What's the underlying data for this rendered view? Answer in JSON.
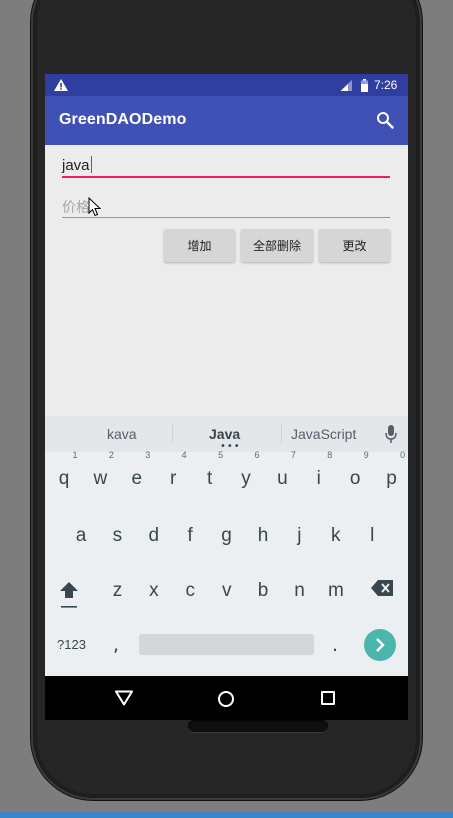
{
  "status_bar": {
    "time": "7:26"
  },
  "app_bar": {
    "title": "GreenDAODemo"
  },
  "form": {
    "name_value": "java",
    "price_placeholder": "价格"
  },
  "buttons": {
    "add": "增加",
    "delete_all": "全部删除",
    "update": "更改"
  },
  "keyboard": {
    "suggestions": [
      "kava",
      "Java",
      "JavaScript"
    ],
    "suggestion_dots": "•••",
    "row1": [
      "q",
      "w",
      "e",
      "r",
      "t",
      "y",
      "u",
      "i",
      "o",
      "p"
    ],
    "row1_hints": [
      "1",
      "2",
      "3",
      "4",
      "5",
      "6",
      "7",
      "8",
      "9",
      "0"
    ],
    "row2": [
      "a",
      "s",
      "d",
      "f",
      "g",
      "h",
      "j",
      "k",
      "l"
    ],
    "row3": [
      "z",
      "x",
      "c",
      "v",
      "b",
      "n",
      "m"
    ],
    "symbols_label": "?123",
    "comma": ",",
    "period": "."
  },
  "colors": {
    "status_bar": "#303f9f",
    "app_bar": "#3f51b5",
    "accent": "#e91e63",
    "go_key": "#4db6ac"
  }
}
